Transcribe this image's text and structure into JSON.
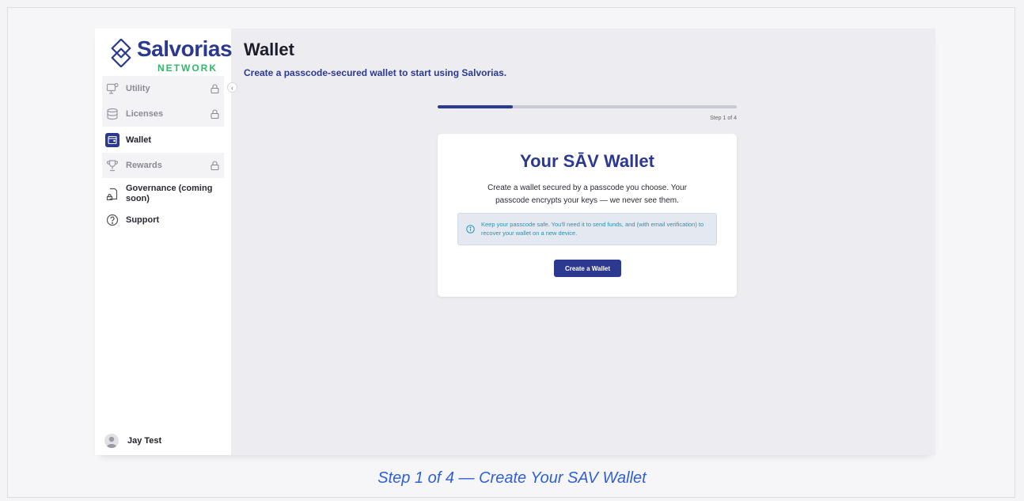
{
  "brand": {
    "name": "Salvorias",
    "subtitle": "NETWORK",
    "primary_color": "#2b3990",
    "accent_color": "#2fb866"
  },
  "sidebar": {
    "collapse_icon": "chevron-left-icon",
    "items": [
      {
        "label": "Utility",
        "icon": "monitor-icon",
        "locked": true
      },
      {
        "label": "Licenses",
        "icon": "database-icon",
        "locked": true
      },
      {
        "label": "Wallet",
        "icon": "wallet-icon",
        "active": true
      },
      {
        "label": "Rewards",
        "icon": "trophy-icon",
        "locked": true
      },
      {
        "label": "Governance (coming soon)",
        "icon": "governance-icon"
      },
      {
        "label": "Support",
        "icon": "help-icon"
      }
    ],
    "user": {
      "name": "Jay Test"
    }
  },
  "header": {
    "title": "Wallet",
    "subtitle": "Create a passcode-secured wallet to start using Salvorias."
  },
  "progress": {
    "value": 0.25,
    "label": "Step 1 of 4"
  },
  "card": {
    "title": "Your SĀV Wallet",
    "description": "Create a wallet secured by a passcode you choose. Your passcode encrypts your keys — we never see them.",
    "info": "Keep your passcode safe. You'll need it to send funds, and (with email verification) to recover your wallet on a new device.",
    "cta_label": "Create a Wallet"
  },
  "caption": "Step 1 of 4 — Create Your SAV Wallet"
}
